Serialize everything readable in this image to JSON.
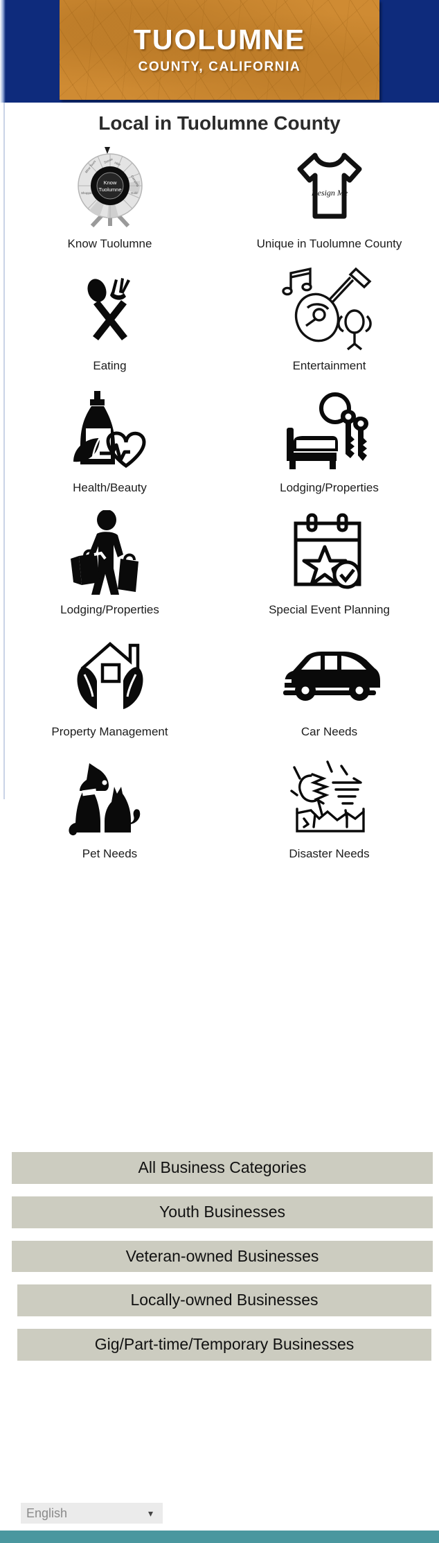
{
  "header": {
    "banner_title": "TUOLUMNE",
    "banner_subtitle": "COUNTY, CALIFORNIA",
    "bar_color": "#0e2b7c",
    "banner_color": "#cf8b33"
  },
  "page": {
    "title": "Local in Tuolumne County"
  },
  "grid": {
    "items": [
      {
        "label": "Know Tuolumne",
        "icon": "prize-wheel-icon",
        "wheel_center_line1": "Know",
        "wheel_center_line2": "Tuolumne"
      },
      {
        "label": "Unique in Tuolumne County",
        "icon": "tshirt-icon",
        "shirt_text": "Design Me"
      },
      {
        "label": "Eating",
        "icon": "spoon-fork-icon"
      },
      {
        "label": "Entertainment",
        "icon": "guitar-music-balloons-icon"
      },
      {
        "label": "Health/Beauty",
        "icon": "lotion-bottle-heart-icon"
      },
      {
        "label": "Lodging/Properties",
        "icon": "bed-keys-icon"
      },
      {
        "label": "Lodging/Properties",
        "icon": "shopper-bags-icon"
      },
      {
        "label": "Special Event Planning",
        "icon": "calendar-star-check-icon"
      },
      {
        "label": "Property Management",
        "icon": "house-in-hands-icon"
      },
      {
        "label": "Car Needs",
        "icon": "car-icon"
      },
      {
        "label": "Pet Needs",
        "icon": "dog-cat-icon"
      },
      {
        "label": "Disaster Needs",
        "icon": "disaster-tornado-icon"
      }
    ]
  },
  "buttons": {
    "button_color": "#ccccc0",
    "items": [
      {
        "label": "All Business Categories"
      },
      {
        "label": "Youth Businesses"
      },
      {
        "label": "Veteran-owned Businesses"
      },
      {
        "label": "Locally-owned Businesses"
      },
      {
        "label": "Gig/Part-time/Temporary Businesses"
      }
    ]
  },
  "language": {
    "selected": "English",
    "options": [
      "English"
    ]
  },
  "footer": {
    "color": "#4a979f"
  }
}
